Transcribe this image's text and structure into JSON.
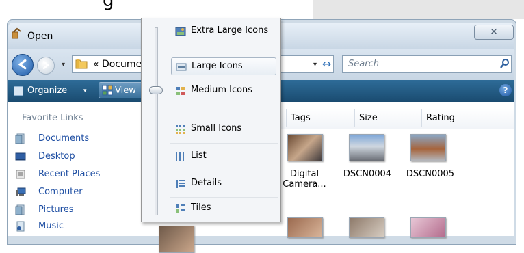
{
  "page": {
    "fragment_title": "g"
  },
  "dialog": {
    "title": "Open",
    "close_symbol": "✕"
  },
  "address": {
    "history_arrow": "▾",
    "path_text": "« Docume",
    "dropdown_arrow": "▾",
    "refresh_symbol": "↔",
    "search_placeholder": "Search"
  },
  "toolbar": {
    "organize_label": "Organize",
    "organize_caret": "▾",
    "views_label": "View",
    "help_symbol": "?"
  },
  "left_pane": {
    "header": "Favorite Links",
    "items": [
      {
        "label": "Documents",
        "icon": "documents-icon"
      },
      {
        "label": "Desktop",
        "icon": "desktop-icon"
      },
      {
        "label": "Recent Places",
        "icon": "recent-places-icon"
      },
      {
        "label": "Computer",
        "icon": "computer-icon"
      },
      {
        "label": "Pictures",
        "icon": "pictures-icon"
      },
      {
        "label": "Music",
        "icon": "music-icon"
      }
    ]
  },
  "columns": {
    "headers": [
      "Tags",
      "Size",
      "Rating"
    ]
  },
  "files": [
    {
      "name": "Digital Camera...",
      "line1": "Digital",
      "line2": "Camera..."
    },
    {
      "name": "DSCN0004",
      "line1": "DSCN0004",
      "line2": ""
    },
    {
      "name": "DSCN0005",
      "line1": "DSCN0005",
      "line2": ""
    }
  ],
  "views_menu": {
    "items": [
      {
        "label": "Extra Large Icons",
        "icon": "extra-large-icons-icon",
        "selected": false
      },
      {
        "label": "Large Icons",
        "icon": "large-icons-icon",
        "selected": true
      },
      {
        "label": "Medium Icons",
        "icon": "medium-icons-icon",
        "selected": false
      },
      {
        "label": "Small Icons",
        "icon": "small-icons-icon",
        "selected": false
      },
      {
        "label": "List",
        "icon": "list-icon",
        "selected": false
      },
      {
        "label": "Details",
        "icon": "details-icon",
        "selected": false
      },
      {
        "label": "Tiles",
        "icon": "tiles-icon",
        "selected": false
      }
    ]
  },
  "colors": {
    "toolbar": "#1a4b70",
    "link_blue": "#1f4fa3",
    "menu_bg": "#f3f5f8"
  }
}
